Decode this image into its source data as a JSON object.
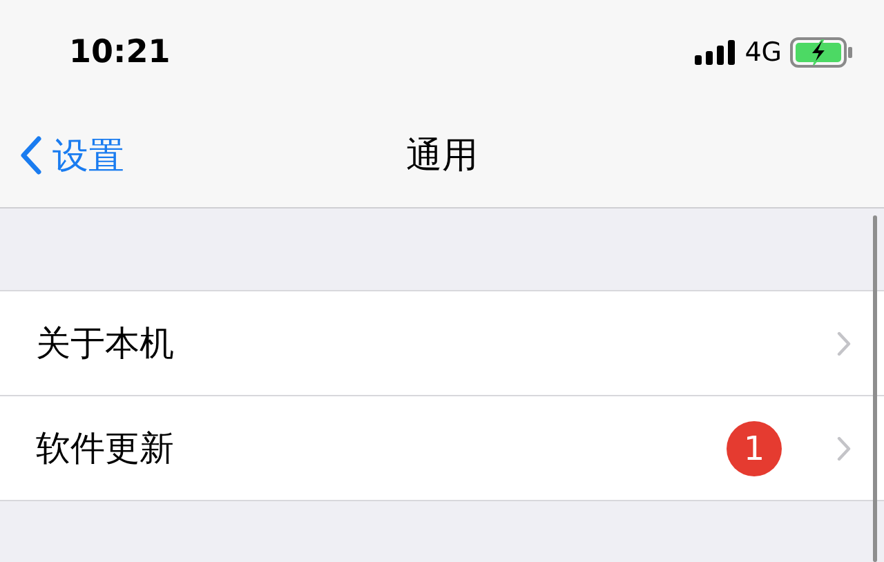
{
  "status_bar": {
    "time": "10:21",
    "network": "4G",
    "charging": true
  },
  "nav": {
    "back": "设置",
    "title": "通用"
  },
  "items": [
    {
      "label": "关于本机"
    },
    {
      "label": "软件更新",
      "badge": "1"
    }
  ]
}
